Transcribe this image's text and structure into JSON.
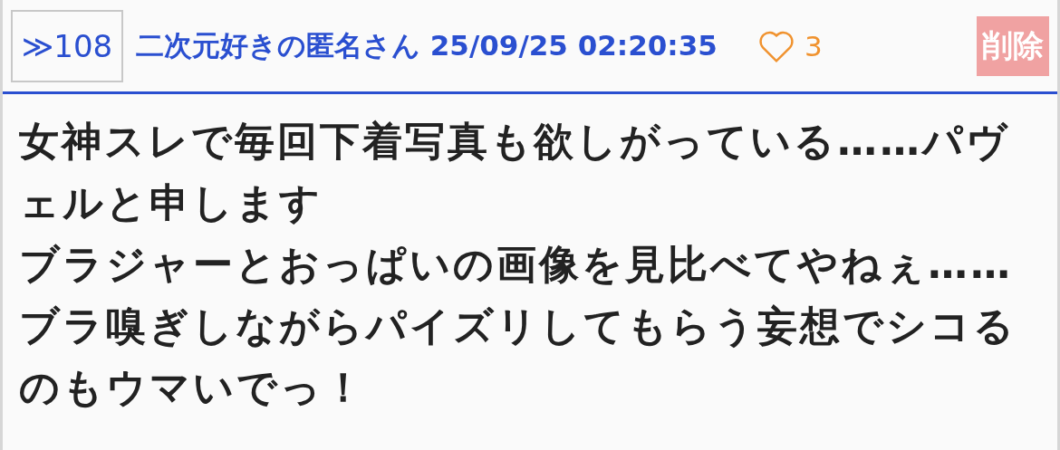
{
  "post": {
    "number": "≫108",
    "name": "二次元好きの匿名さん",
    "date": "25/09/25 02:20:35",
    "likes": "3",
    "delete_button": "削除"
  },
  "body": [
    "女神スレで毎回下着写真も欲しがっている……パヴェルと申します",
    "ブラジャーとおっぱいの画像を見比べてやねぇ……",
    "ブラ嗅ぎしながらパイズリしてもらう妄想でシコるのもウマいでっ！"
  ]
}
